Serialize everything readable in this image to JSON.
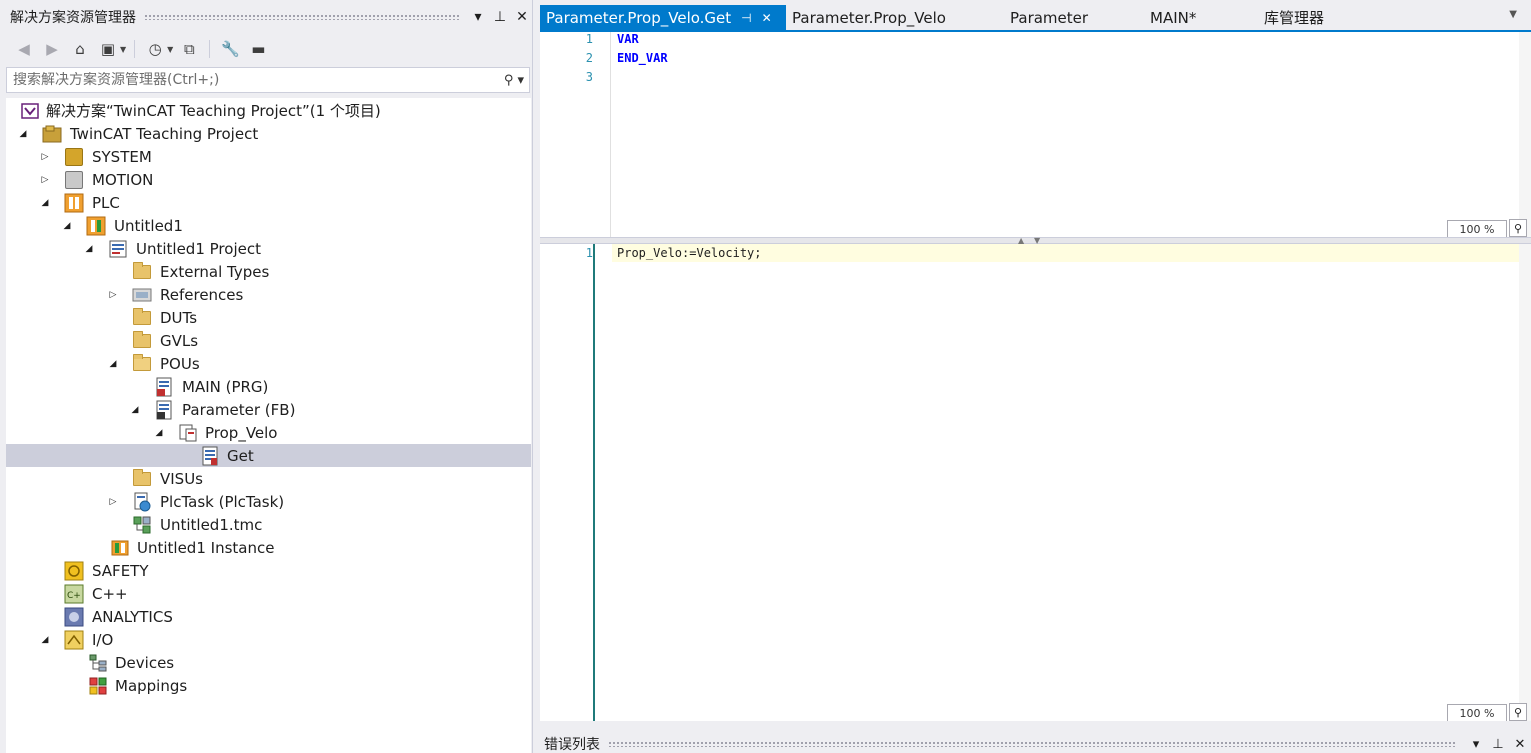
{
  "solution_explorer": {
    "title": "解决方案资源管理器",
    "search_placeholder": "搜索解决方案资源管理器(Ctrl+;)",
    "pin_icon": "pin-icon",
    "close_icon": "close-icon",
    "tree": [
      {
        "label": "解决方案“TwinCAT Teaching Project”(1 个项目)",
        "icon": "solution-icon",
        "expanded": null
      },
      {
        "label": "TwinCAT Teaching Project",
        "icon": "twincat-project-icon",
        "expanded": true
      },
      {
        "label": "SYSTEM",
        "icon": "system-icon",
        "expanded": false
      },
      {
        "label": "MOTION",
        "icon": "motion-icon",
        "expanded": false
      },
      {
        "label": "PLC",
        "icon": "plc-icon",
        "expanded": true
      },
      {
        "label": "Untitled1",
        "icon": "plc-project-icon",
        "expanded": true
      },
      {
        "label": "Untitled1 Project",
        "icon": "project-icon",
        "expanded": true
      },
      {
        "label": "External Types",
        "icon": "folder-icon",
        "expanded": null
      },
      {
        "label": "References",
        "icon": "references-icon",
        "expanded": false
      },
      {
        "label": "DUTs",
        "icon": "folder-icon",
        "expanded": null
      },
      {
        "label": "GVLs",
        "icon": "folder-icon",
        "expanded": null
      },
      {
        "label": "POUs",
        "icon": "folder-open-icon",
        "expanded": true
      },
      {
        "label": "MAIN (PRG)",
        "icon": "program-icon",
        "expanded": null
      },
      {
        "label": "Parameter (FB)",
        "icon": "function-block-icon",
        "expanded": true
      },
      {
        "label": "Prop_Velo",
        "icon": "property-icon",
        "expanded": true
      },
      {
        "label": "Get",
        "icon": "property-get-icon",
        "expanded": null,
        "selected": true
      },
      {
        "label": "VISUs",
        "icon": "folder-icon",
        "expanded": null
      },
      {
        "label": "PlcTask (PlcTask)",
        "icon": "task-icon",
        "expanded": false
      },
      {
        "label": "Untitled1.tmc",
        "icon": "tmc-icon",
        "expanded": null
      },
      {
        "label": "Untitled1 Instance",
        "icon": "instance-icon",
        "expanded": null
      },
      {
        "label": "SAFETY",
        "icon": "safety-icon",
        "expanded": null
      },
      {
        "label": "C++",
        "icon": "cpp-icon",
        "expanded": null
      },
      {
        "label": "ANALYTICS",
        "icon": "analytics-icon",
        "expanded": null
      },
      {
        "label": "I/O",
        "icon": "io-icon",
        "expanded": true
      },
      {
        "label": "Devices",
        "icon": "devices-icon",
        "expanded": null
      },
      {
        "label": "Mappings",
        "icon": "mappings-icon",
        "expanded": null
      }
    ]
  },
  "editor": {
    "tabs": [
      {
        "label": "Parameter.Prop_Velo.Get",
        "active": true
      },
      {
        "label": "Parameter.Prop_Velo",
        "active": false
      },
      {
        "label": "Parameter",
        "active": false
      },
      {
        "label": "MAIN*",
        "active": false
      },
      {
        "label": "库管理器",
        "active": false
      }
    ],
    "decl_lines": [
      "1",
      "2",
      "3"
    ],
    "decl_code": [
      "VAR",
      "END_VAR",
      ""
    ],
    "impl_lines": [
      "1"
    ],
    "impl_code": [
      "Prop_Velo:=Velocity;"
    ],
    "zoom_top": "100 %",
    "zoom_bottom": "100 %"
  },
  "bottom_panel": {
    "title": "错误列表"
  },
  "colors": {
    "accent": "#007acc",
    "selection": "#cccedb",
    "keyword": "#0000ff",
    "line_number": "#2b91af"
  }
}
